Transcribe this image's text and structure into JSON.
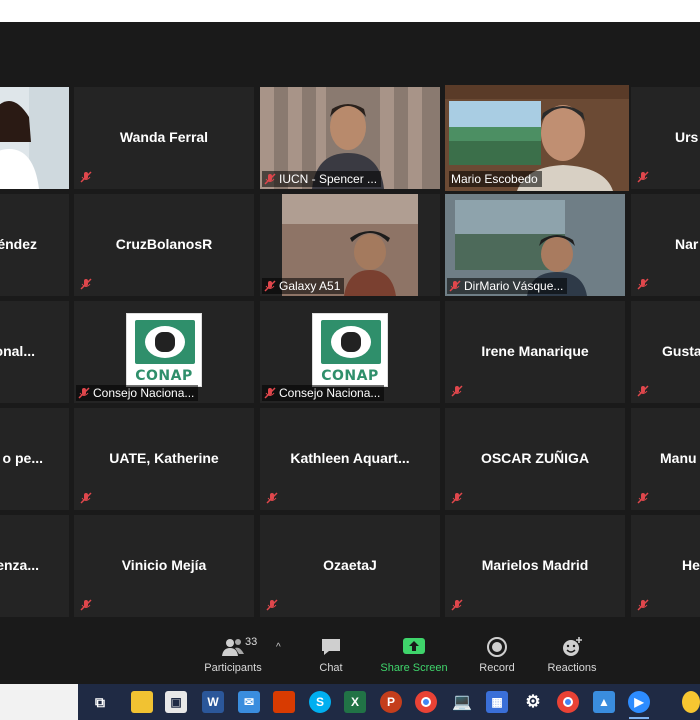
{
  "participants_tiles": [
    {
      "name": "Wanda Ferral"
    },
    {
      "name": "Urs"
    },
    {
      "name": "éndez"
    },
    {
      "name": "CruzBolanosR"
    },
    {
      "name": "Nar"
    },
    {
      "name": "onal..."
    },
    {
      "name": "Irene Manarique"
    },
    {
      "name": "Gusta"
    },
    {
      "name": "o  pe..."
    },
    {
      "name": "UATE, Katherine"
    },
    {
      "name": "Kathleen  Aquart..."
    },
    {
      "name": "OSCAR ZUÑIGA"
    },
    {
      "name": "Manu"
    },
    {
      "name": "enza..."
    },
    {
      "name": "Vinicio Mejía"
    },
    {
      "name": "OzaetaJ"
    },
    {
      "name": "Marielos Madrid"
    },
    {
      "name": "He"
    }
  ],
  "video_labels": {
    "iucn": "IUCN - Spencer ...",
    "mario": "Mario Escobedo",
    "galaxy": "Galaxy A51",
    "dirmario": "DirMario Vásque...",
    "conap1": "Consejo Naciona...",
    "conap2": "Consejo Naciona..."
  },
  "conap_logo_text": "CONAP",
  "toolbar": {
    "participants_label": "Participants",
    "participants_count": "33",
    "chat_label": "Chat",
    "share_label": "Share Screen",
    "record_label": "Record",
    "reactions_label": "Reactions"
  },
  "colors": {
    "active_speaker": "#c8e06c",
    "share_green": "#3fd46b",
    "muted_red": "#e0474c"
  },
  "taskbar_icons": [
    "task-view-icon",
    "file-explorer-icon",
    "store-icon",
    "word-icon",
    "mail-icon",
    "office-icon",
    "skype-icon",
    "excel-icon",
    "powerpoint-icon",
    "chrome-icon",
    "laptop-icon",
    "calendar-icon",
    "settings-icon",
    "chrome-profile-icon",
    "photos-icon",
    "zoom-icon"
  ]
}
